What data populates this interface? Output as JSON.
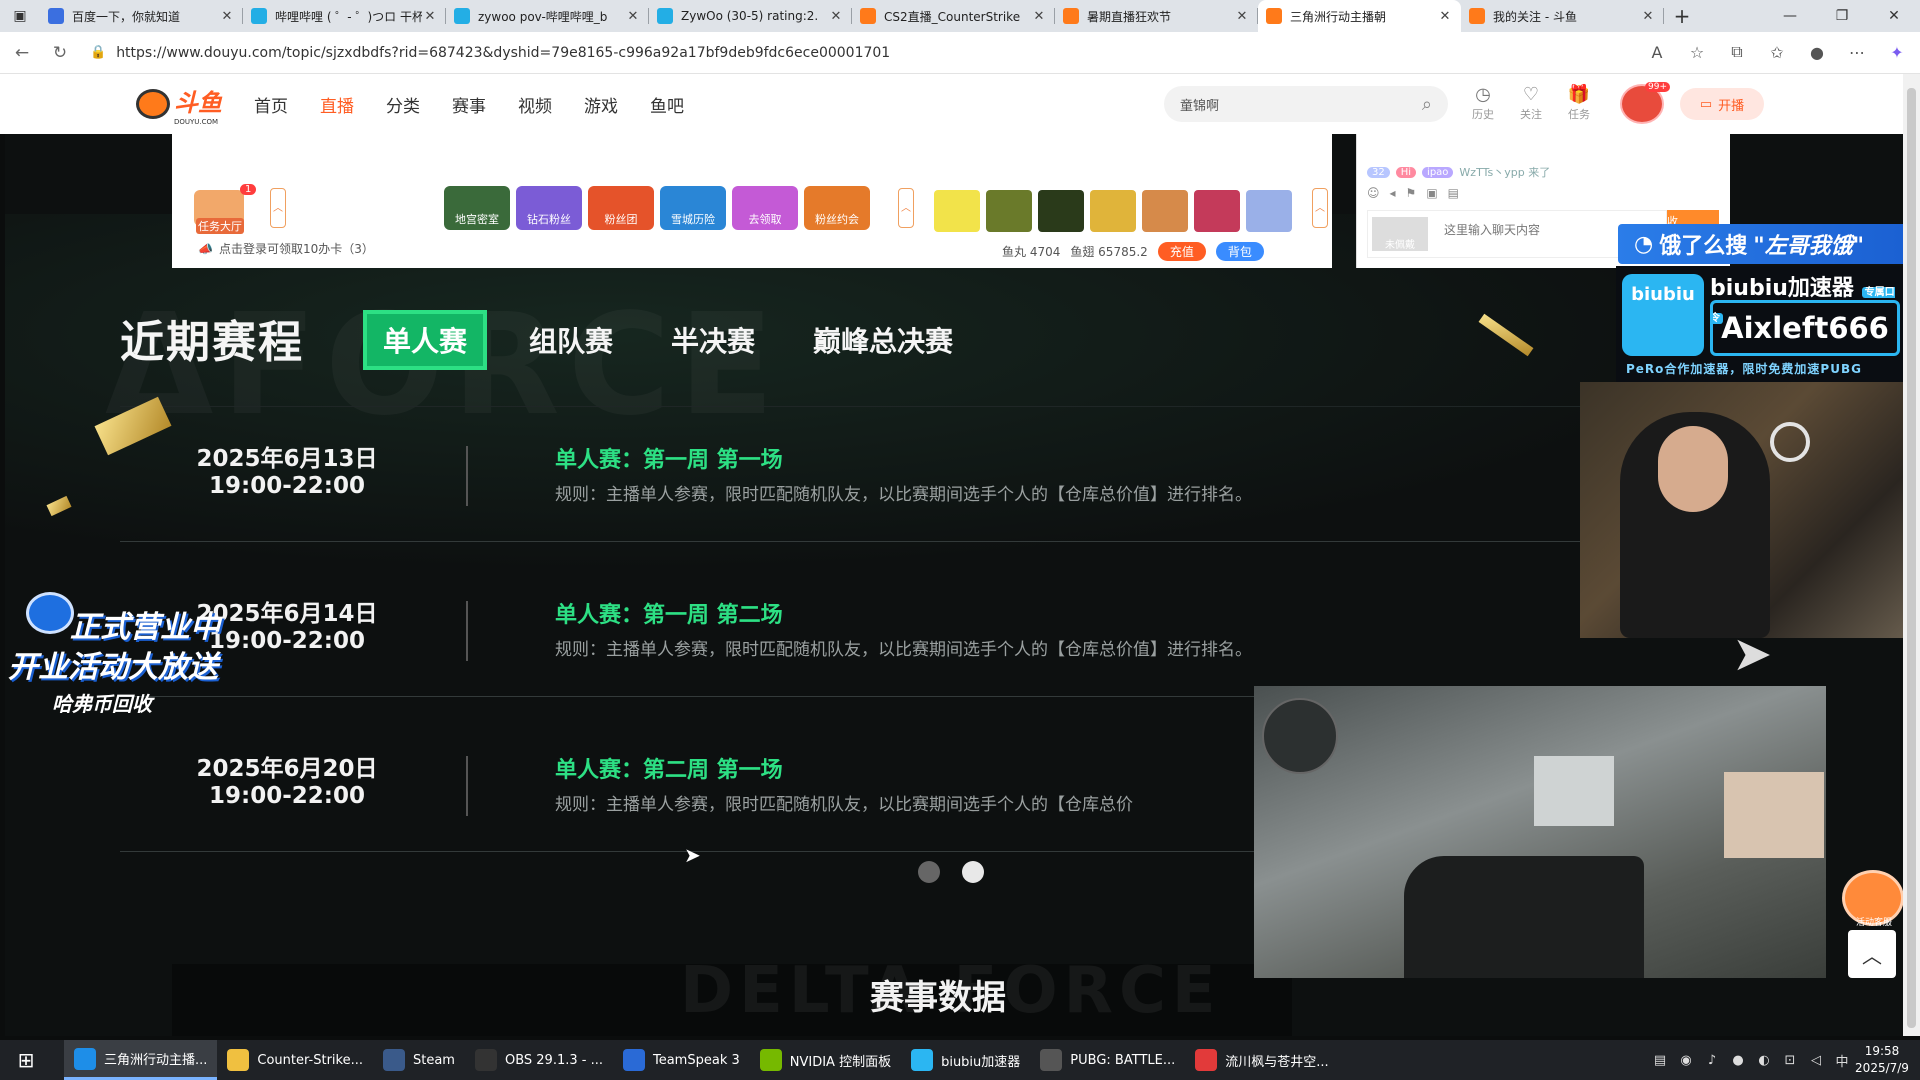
{
  "browser": {
    "tabs": [
      {
        "title": "百度一下，你就知道",
        "fav_color": "#3b6fe0",
        "fav": "du"
      },
      {
        "title": "哔哩哔哩 ( ゜- ゜)つロ 干杯",
        "fav_color": "#23aee5",
        "fav": "tv"
      },
      {
        "title": "zywoo pov-哔哩哔哩_b",
        "fav_color": "#23aee5",
        "fav": "tv"
      },
      {
        "title": "ZywOo (30-5) rating:2.",
        "fav_color": "#23aee5",
        "fav": "tv"
      },
      {
        "title": "CS2直播_CounterStrike",
        "fav_color": "#ff7a1a",
        "fav": "dy"
      },
      {
        "title": "暑期直播狂欢节",
        "fav_color": "#ff7a1a",
        "fav": "dy"
      },
      {
        "title": "三角洲行动主播朝",
        "fav_color": "#ff7a1a",
        "fav": "dy",
        "active": true
      },
      {
        "title": "我的关注 - 斗鱼",
        "fav_color": "#ff7a1a",
        "fav": "dy"
      }
    ],
    "url": "https://www.douyu.com/topic/sjzxdbdfs?rid=687423&dyshid=79e8165-c996a92a17bf9deb9fdc6ece00001701"
  },
  "header": {
    "logo_text": "斗鱼",
    "logo_sub": "DOUYU.COM",
    "nav": [
      "首页",
      "直播",
      "分类",
      "赛事",
      "视频",
      "游戏",
      "鱼吧"
    ],
    "nav_active": "直播",
    "search_placeholder": "童锦啊",
    "icons": [
      {
        "label": "历史",
        "name": "history-icon",
        "glyph": "◷"
      },
      {
        "label": "关注",
        "name": "heart-icon",
        "glyph": "♡"
      },
      {
        "label": "任务",
        "name": "gift-icon",
        "glyph": "🎁"
      }
    ],
    "avatar_badge": "99+",
    "broadcast_label": "开播"
  },
  "gift_panel": {
    "task_label": "任务大厅",
    "task_badge": "1",
    "items": [
      {
        "label": "地宫密室",
        "color": "#3a6a3a"
      },
      {
        "label": "钻石粉丝",
        "color": "#7b5cd6"
      },
      {
        "label": "粉丝团",
        "color": "#e5532a"
      },
      {
        "label": "雪城历险",
        "color": "#2a86d6"
      },
      {
        "label": "去领取",
        "color": "#c45ad6"
      },
      {
        "label": "粉丝约会",
        "color": "#e57a2a"
      }
    ],
    "gift_squares": [
      "#f2e34a",
      "#6a7a2a",
      "#2a3a1a",
      "#e0b43a",
      "#d68a4a",
      "#c43a5a",
      "#9ab0e8"
    ],
    "promo": "点击登录可领取10办卡（3）",
    "fish_ball": "鱼丸 4704",
    "fish_wing": "鱼翅 65785.2",
    "recharge": "充值",
    "backpack": "背包"
  },
  "chat": {
    "tag1": "32",
    "tag2": "Hi",
    "tag3": "ipao",
    "user_line": "WzTTs丶ypp 来了",
    "placeholder": "这里输入聊天内容",
    "avatar_label": "未佩戴",
    "send": "收"
  },
  "schedule": {
    "title": "近期赛程",
    "tabs": [
      "单人赛",
      "组队赛",
      "半决赛",
      "巅峰总决赛"
    ],
    "active_tab": "单人赛",
    "rows": [
      {
        "date": "2025年6月13日",
        "time": "19:00-22:00",
        "title": "单人赛：第一周 第一场",
        "rule": "规则：主播单人参赛，限时匹配随机队友，以比赛期间选手个人的【仓库总价值】进行排名。"
      },
      {
        "date": "2025年6月14日",
        "time": "19:00-22:00",
        "title": "单人赛：第一周 第二场",
        "rule": "规则：主播单人参赛，限时匹配随机队友，以比赛期间选手个人的【仓库总价值】进行排名。"
      },
      {
        "date": "2025年6月20日",
        "time": "19:00-22:00",
        "title": "单人赛：第二周 第一场",
        "rule": "规则：主播单人参赛，限时匹配随机队友，以比赛期间选手个人的【仓库总价"
      }
    ],
    "data_title": "赛事数据",
    "bg_word": "DELTA FORCE"
  },
  "overlays": {
    "eleme": "饿了么搜",
    "eleme_quote": "\"左哥我饿\"",
    "biu_title": "biubiu加速器",
    "biu_tag": "专属口令",
    "biu_logo": "biubiu",
    "biu_code": "Aixleft666",
    "biu_sub": "PeRo合作加速器，限时免费加速PUBG",
    "promo_l1": "正式营业中",
    "promo_l2": "开业活动大放送",
    "promo_l3": "哈弗币回收",
    "service_label": "活动客服"
  },
  "taskbar": {
    "items": [
      {
        "label": "三角洲行动主播...",
        "color": "#1e8ee8",
        "active": true
      },
      {
        "label": "Counter-Strike...",
        "color": "#f0c040"
      },
      {
        "label": "Steam",
        "color": "#3a5a8a"
      },
      {
        "label": "OBS 29.1.3 - ...",
        "color": "#333"
      },
      {
        "label": "TeamSpeak 3",
        "color": "#2a6ad6"
      },
      {
        "label": "NVIDIA 控制面板",
        "color": "#76b900"
      },
      {
        "label": "biubiu加速器",
        "color": "#2bb6f2"
      },
      {
        "label": "PUBG: BATTLE...",
        "color": "#555"
      },
      {
        "label": "流川枫与苍井空...",
        "color": "#e23a3a"
      }
    ],
    "ime": "中",
    "time": "19:58",
    "date": "2025/7/9"
  }
}
